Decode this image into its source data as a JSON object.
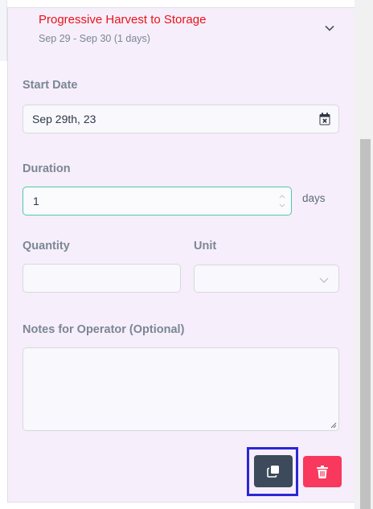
{
  "step": {
    "title": "Progressive Harvest to Storage",
    "dates": "Sep 29 - Sep 30 (1 days)"
  },
  "start_date": {
    "label": "Start Date",
    "value": "Sep 29th, 23"
  },
  "duration": {
    "label": "Duration",
    "value": "1",
    "unit": "days"
  },
  "quantity": {
    "label": "Quantity",
    "value": ""
  },
  "unit": {
    "label": "Unit",
    "value": ""
  },
  "notes": {
    "label": "Notes for Operator (Optional)",
    "value": ""
  },
  "colors": {
    "title_red": "#e8131b",
    "focus_border": "#4cc9a8",
    "copy_button": "#3c4a5c",
    "delete_button": "#f8385c",
    "highlight": "#2b27d4"
  }
}
